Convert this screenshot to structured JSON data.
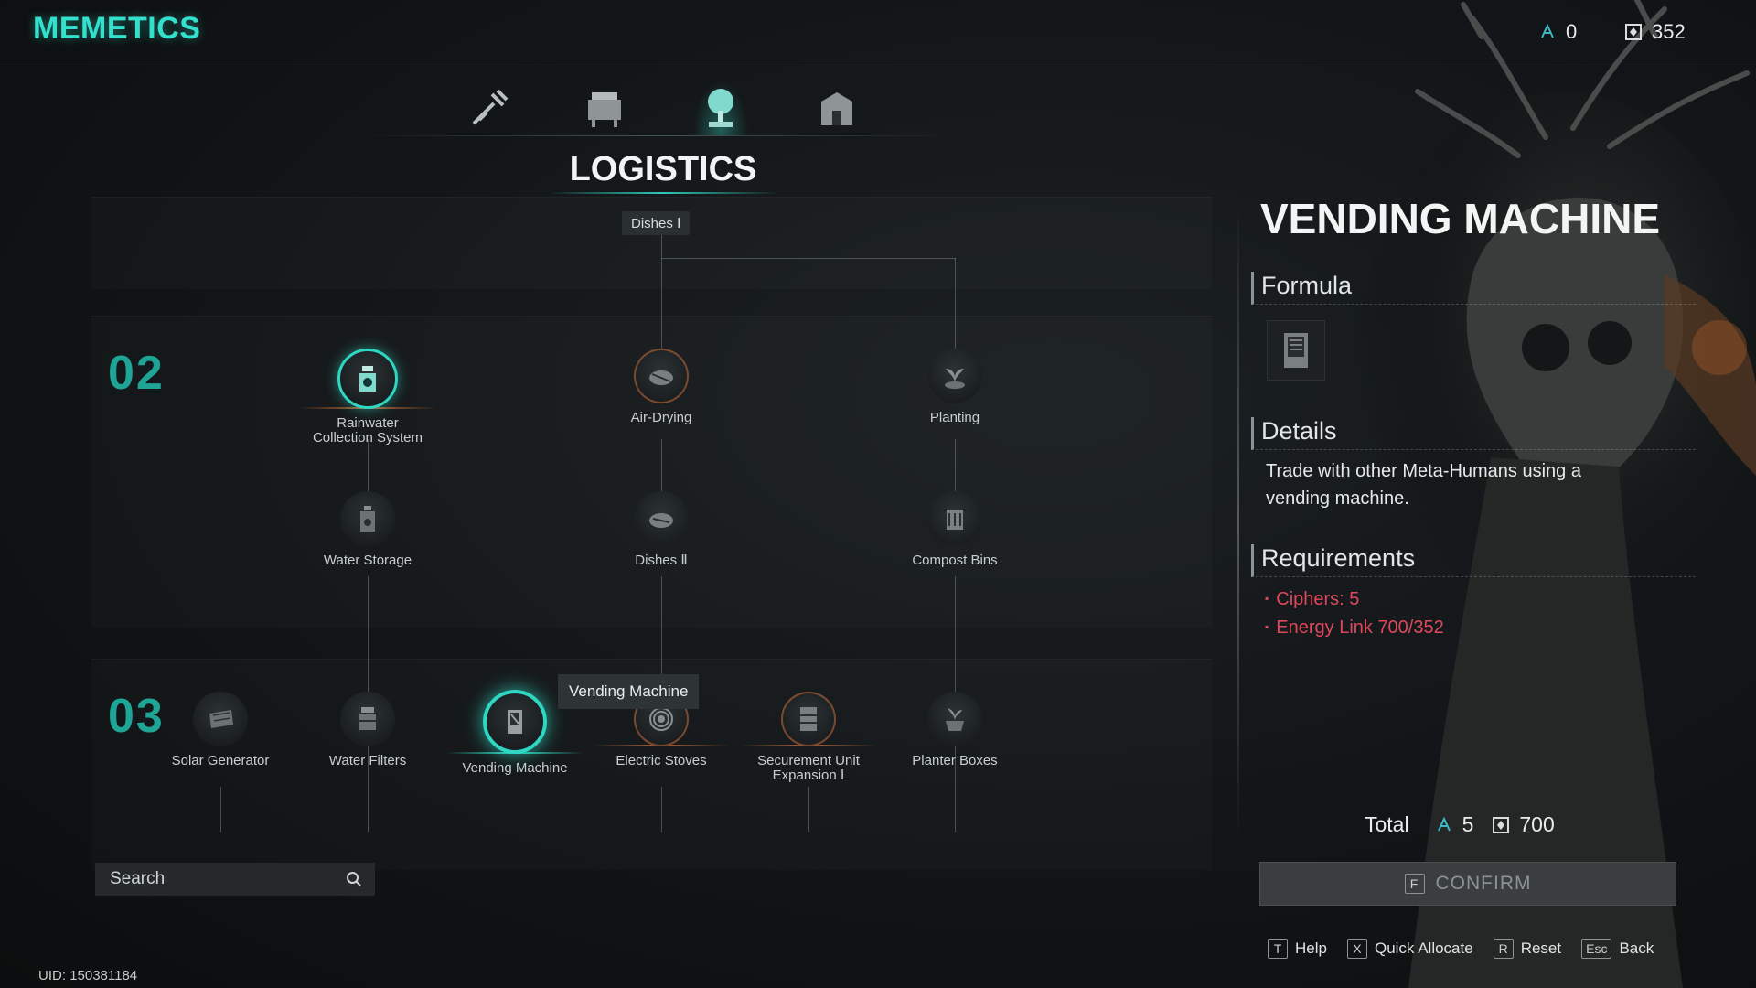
{
  "app_title": "MEMETICS",
  "currency": {
    "ciphers": "0",
    "energy_link": "352"
  },
  "category_tabs": [
    {
      "icon": "wrench-tools-icon"
    },
    {
      "icon": "workbench-icon"
    },
    {
      "icon": "tree-logistics-icon"
    },
    {
      "icon": "building-icon"
    }
  ],
  "section_title": "LOGISTICS",
  "root_node": "Dishes Ⅰ",
  "tiers": [
    "02",
    "03"
  ],
  "nodes": {
    "rainwater": "Rainwater\nCollection System",
    "air_drying": "Air-Drying",
    "planting": "Planting",
    "water_storage": "Water Storage",
    "dishes_ii": "Dishes Ⅱ",
    "compost_bins": "Compost Bins",
    "solar_generator": "Solar Generator",
    "water_filters": "Water Filters",
    "vending_machine": "Vending Machine",
    "electric_stoves": "Electric Stoves",
    "securement_unit": "Securement Unit\nExpansion Ⅰ",
    "planter_boxes": "Planter Boxes"
  },
  "tooltip": "Vending Machine",
  "search": {
    "placeholder": "Search"
  },
  "uid": "UID: 150381184",
  "detail": {
    "title": "VENDING MACHINE",
    "formula_label": "Formula",
    "details_label": "Details",
    "details_text": "Trade with other Meta-Humans using a vending machine.",
    "requirements_label": "Requirements",
    "requirements": [
      "Ciphers:  5",
      "Energy Link 700/352"
    ],
    "total_label": "Total",
    "total_ciphers": "5",
    "total_energy": "700",
    "confirm_key": "F",
    "confirm_label": "CONFIRM"
  },
  "hints": [
    {
      "key": "T",
      "label": "Help"
    },
    {
      "key": "X",
      "label": "Quick Allocate"
    },
    {
      "key": "R",
      "label": "Reset"
    },
    {
      "key": "Esc",
      "label": "Back"
    }
  ],
  "colors": {
    "accent": "#2fd6c1",
    "title": "#33e0cc",
    "requirement_unmet": "#e0475c",
    "available_ring": "#b8622f"
  }
}
